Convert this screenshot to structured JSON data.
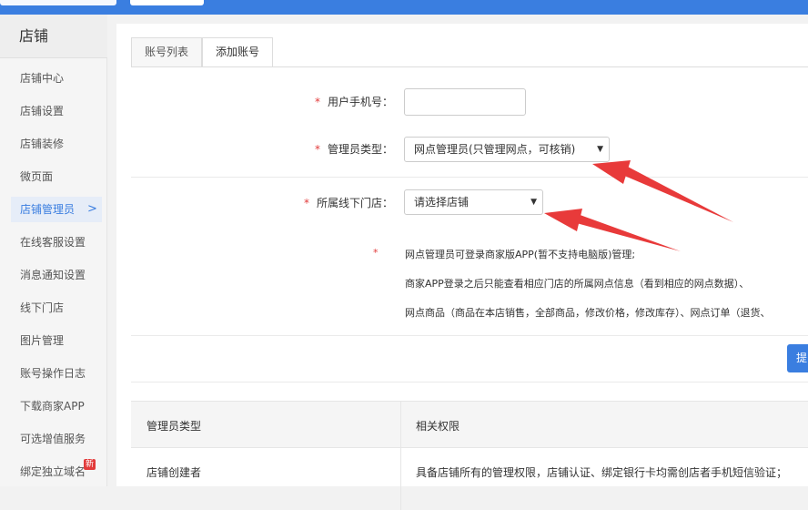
{
  "sidebar": {
    "title": "店铺",
    "items": [
      {
        "label": "店铺中心"
      },
      {
        "label": "店铺设置"
      },
      {
        "label": "店铺装修"
      },
      {
        "label": "微页面"
      },
      {
        "label": "店铺管理员",
        "active": true,
        "chevron": ">"
      },
      {
        "label": "在线客服设置"
      },
      {
        "label": "消息通知设置"
      },
      {
        "label": "线下门店"
      },
      {
        "label": "图片管理"
      },
      {
        "label": "账号操作日志"
      },
      {
        "label": "下载商家APP"
      },
      {
        "label": "可选增值服务"
      },
      {
        "label": "绑定独立域名",
        "badge": "新"
      }
    ]
  },
  "tabs": [
    {
      "label": "账号列表"
    },
    {
      "label": "添加账号",
      "active": true
    }
  ],
  "form": {
    "required_mark": "*",
    "phone_label": "用户手机号：",
    "phone_value": "",
    "admin_type_label": "管理员类型：",
    "admin_type_value": "网点管理员(只管理网点，可核销)",
    "store_label": "所属线下门店：",
    "store_value": "请选择店铺",
    "caret": "▼"
  },
  "notes": {
    "mark": "*",
    "line1": "网点管理员可登录商家版APP(暂不支持电脑版)管理;",
    "line2": "商家APP登录之后只能查看相应门店的所属网点信息（看到相应的网点数据）、",
    "line3": "网点商品（商品在本店销售，全部商品，修改价格，修改库存）、网点订单（退货、"
  },
  "submit_label": "提",
  "table": {
    "headers": [
      "管理员类型",
      "相关权限"
    ],
    "rows": [
      [
        "店铺创建者",
        "具备店铺所有的管理权限，店铺认证、绑定银行卡均需创店者手机短信验证；"
      ]
    ]
  },
  "colors": {
    "accent": "#3a7ee0",
    "required": "#e23b3b",
    "arrow": "#e83a3a"
  }
}
